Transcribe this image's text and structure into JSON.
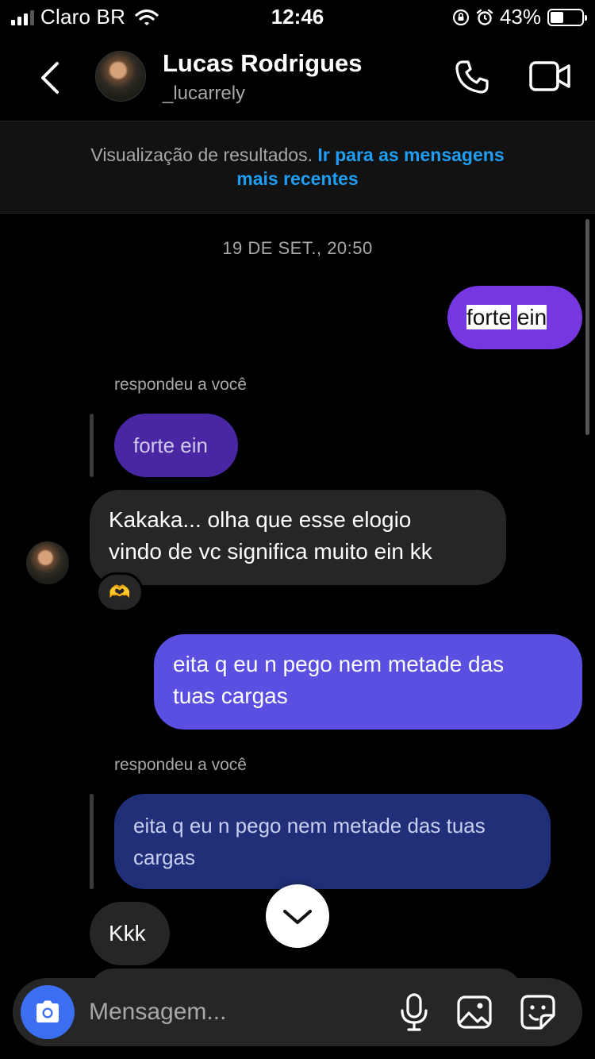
{
  "status_bar": {
    "carrier": "Claro BR",
    "time": "12:46",
    "battery_percent": "43%",
    "battery_level": 0.43,
    "signal_bars": 3,
    "icons": [
      "signal-icon",
      "wifi-icon",
      "orientation-lock-icon",
      "alarm-icon",
      "battery-icon"
    ]
  },
  "header": {
    "back_icon": "chevron-left-icon",
    "name": "Lucas Rodrigues",
    "username": "_lucarrely",
    "call_icon": "phone-icon",
    "video_icon": "video-camera-icon"
  },
  "search_banner": {
    "text": "Visualização de resultados.",
    "link_line1": "Ir para as mensagens",
    "link_line2": "mais recentes"
  },
  "chat": {
    "timestamp": "19 DE SET., 20:50",
    "messages": [
      {
        "type": "sent",
        "words": [
          "forte",
          "ein"
        ]
      },
      {
        "type": "reply_label",
        "text": "respondeu a você"
      },
      {
        "type": "quoted",
        "text": "forte ein"
      },
      {
        "type": "received",
        "line1": "Kakaka... olha que esse elogio",
        "line2": "vindo de vc significa muito ein kk",
        "reaction": "🫶"
      },
      {
        "type": "sent",
        "line1": "eita q eu n pego nem metade das",
        "line2": "tuas cargas"
      },
      {
        "type": "reply_label",
        "text": "respondeu a você"
      },
      {
        "type": "quoted",
        "line1": "eita q eu n pego nem metade das tuas",
        "line2": "cargas"
      },
      {
        "type": "received",
        "text": "Kkk"
      }
    ],
    "scroll_down_icon": "chevron-down-icon"
  },
  "composer": {
    "placeholder": "Mensagem...",
    "camera_icon": "camera-icon",
    "mic_icon": "microphone-icon",
    "gallery_icon": "image-icon",
    "sticker_icon": "sticker-icon"
  },
  "colors": {
    "sent_purple": "#7637e0",
    "sent_indigo": "#5a4fe0",
    "quoted_purple": "#4a27a2",
    "quoted_navy": "#202f78",
    "received": "#262626",
    "link_blue": "#1f9ef5",
    "camera_blue": "#3b6ef0"
  }
}
